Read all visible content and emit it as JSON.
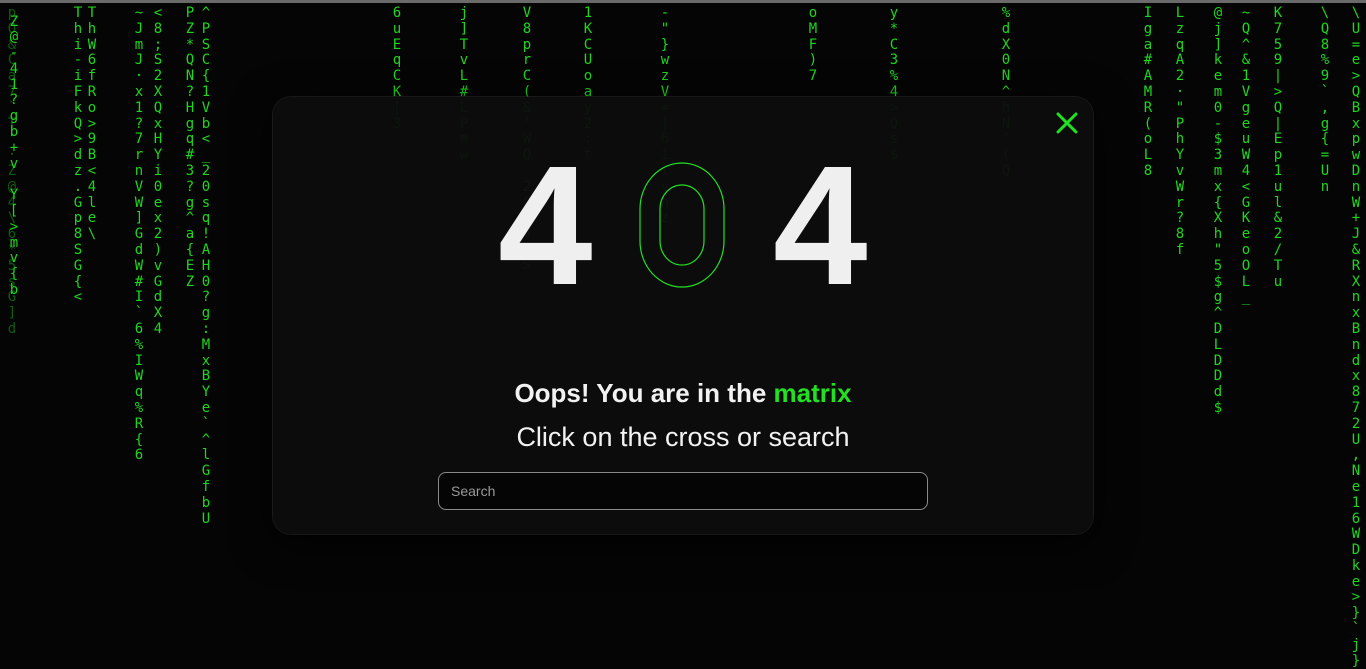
{
  "colors": {
    "accent": "#22e022",
    "rain_bright": "#1ed61e",
    "rain_dim": "#0f5c0f",
    "background": "#050505",
    "modal": "#0c0c0c"
  },
  "modal": {
    "code_digit_1": "4",
    "code_digit_2": "0",
    "code_digit_3": "4",
    "title_prefix": "Oops! You are in the ",
    "title_accent": "matrix",
    "subtitle": "Click on the cross or search",
    "search_placeholder": "Search",
    "close_icon": "close-icon"
  },
  "matrix_columns": [
    {
      "text": "pO&Ca7`T'·Z@4\\6*5sG]d",
      "tone": "dim"
    },
    {
      "text": "                 Z@-41?gb+v Y[>mv{b",
      "tone": "bright"
    },
    {
      "text": "ThW6fRo>9B<4le\\",
      "tone": "bright"
    },
    {
      "text": "Thi-iFkQ>dz.Gp8SG{<",
      "tone": "bright"
    },
    {
      "text": "~JmJ·x1?7rnVW]GdW#I`6%IWq%R{6",
      "tone": "bright"
    },
    {
      "text": "<8;S2XQxHYi0ex2)vGdX4",
      "tone": "bright"
    },
    {
      "text": "PZ*QN?Hgq#3?g^a{EZ",
      "tone": "bright"
    },
    {
      "text": "^PSC{1Vb<_20sq!AH0?g:MxBYe`^lGfbU",
      "tone": "bright"
    },
    {
      "text": "6uEqCK|3",
      "tone": "bright"
    },
    {
      "text": "j]TvL#LPmw",
      "tone": "bright"
    },
    {
      "text": "V8prC(&'WQ_2CYVK>",
      "tone": "bright"
    },
    {
      "text": "1KCUoay2:t",
      "tone": "bright"
    },
    {
      "text": "-\"}wzV=|6ilynz",
      "tone": "bright"
    },
    {
      "text": "oMF)7",
      "tone": "bright"
    },
    {
      "text": "y*C3%4>Qs$",
      "tone": "bright"
    },
    {
      "text": "%dX0N^hN^(Q",
      "tone": "bright"
    },
    {
      "text": "Iga#AMR(oL8",
      "tone": "bright"
    },
    {
      "text": "LzqA2·\"PhYvWr?8f",
      "tone": "bright"
    },
    {
      "text": "@j]kem0-$3mx{Xh\"5$g^DLDDd$",
      "tone": "bright"
    },
    {
      "text": "~Q^&1VgeuW4<GKeoOL_",
      "tone": "bright"
    },
    {
      "text": "K759|>Q|Ep1ul&2/Tu",
      "tone": "bright"
    },
    {
      "text": "\\Q8%9`,g{=Un",
      "tone": "bright"
    },
    {
      "text": "\\U=e>QBxpwDnW+J&RXnxBndx872U,Ne16WDke>}`j}",
      "tone": "bright"
    }
  ]
}
